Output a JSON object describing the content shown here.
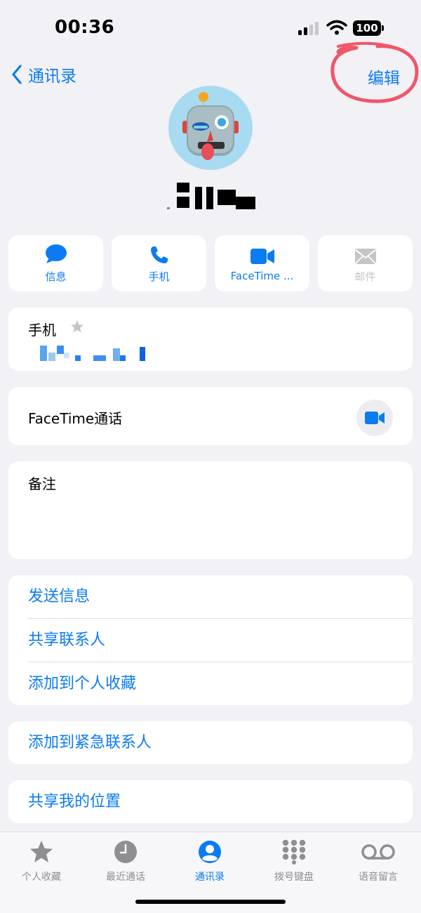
{
  "status_bar": {
    "time": "00:36",
    "battery": "100"
  },
  "nav": {
    "back_label": "通讯录",
    "edit_label": "编辑"
  },
  "actions": [
    {
      "label": "信息",
      "icon": "message-bubble-icon",
      "enabled": true
    },
    {
      "label": "手机",
      "icon": "phone-icon",
      "enabled": true
    },
    {
      "label": "FaceTime ...",
      "icon": "video-camera-icon",
      "enabled": true
    },
    {
      "label": "邮件",
      "icon": "mail-icon",
      "enabled": false
    }
  ],
  "phone_card": {
    "label": "手机"
  },
  "facetime_card": {
    "label": "FaceTime通话"
  },
  "notes_card": {
    "label": "备注"
  },
  "link_group_1": [
    "发送信息",
    "共享联系人",
    "添加到个人收藏"
  ],
  "link_group_2": [
    "添加到紧急联系人"
  ],
  "link_group_3": [
    "共享我的位置"
  ],
  "tab_bar": [
    {
      "label": "个人收藏",
      "icon": "star-icon",
      "active": false
    },
    {
      "label": "最近通话",
      "icon": "clock-icon",
      "active": false
    },
    {
      "label": "通讯录",
      "icon": "contact-person-icon",
      "active": true
    },
    {
      "label": "拨号键盘",
      "icon": "keypad-icon",
      "active": false
    },
    {
      "label": "语音留言",
      "icon": "voicemail-icon",
      "active": false
    }
  ],
  "colors": {
    "accent": "#0b7bf2",
    "background": "#f2f1f6",
    "annotation": "#f0566a"
  }
}
